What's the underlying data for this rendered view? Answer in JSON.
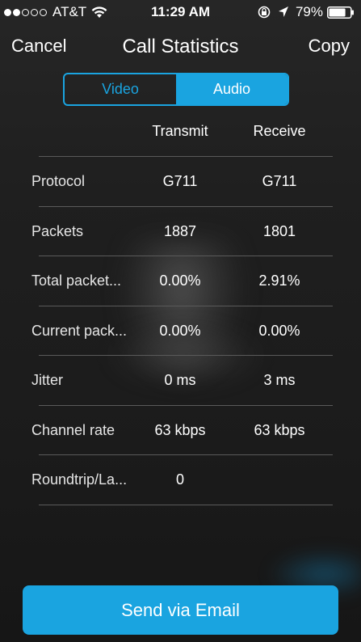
{
  "status_bar": {
    "carrier": "AT&T",
    "signal_filled": 2,
    "signal_total": 5,
    "time": "11:29 AM",
    "battery": "79%",
    "battery_level": 0.79
  },
  "nav": {
    "cancel": "Cancel",
    "title": "Call Statistics",
    "copy": "Copy"
  },
  "segments": [
    {
      "label": "Video",
      "selected": false
    },
    {
      "label": "Audio",
      "selected": true
    }
  ],
  "table": {
    "columns": [
      "Transmit",
      "Receive"
    ],
    "rows": [
      {
        "label": "Protocol",
        "transmit": "G711",
        "receive": "G711"
      },
      {
        "label": "Packets",
        "transmit": "1887",
        "receive": "1801"
      },
      {
        "label": "Total packet...",
        "transmit": "0.00%",
        "receive": "2.91%"
      },
      {
        "label": "Current pack...",
        "transmit": "0.00%",
        "receive": "0.00%"
      },
      {
        "label": "Jitter",
        "transmit": "0 ms",
        "receive": "3 ms"
      },
      {
        "label": "Channel rate",
        "transmit": "63 kbps",
        "receive": "63 kbps"
      },
      {
        "label": "Roundtrip/La...",
        "transmit": "0",
        "receive": ""
      }
    ]
  },
  "footer": {
    "email_button": "Send via Email"
  },
  "colors": {
    "accent": "#1aa4e0",
    "background": "#1c1c1c"
  }
}
